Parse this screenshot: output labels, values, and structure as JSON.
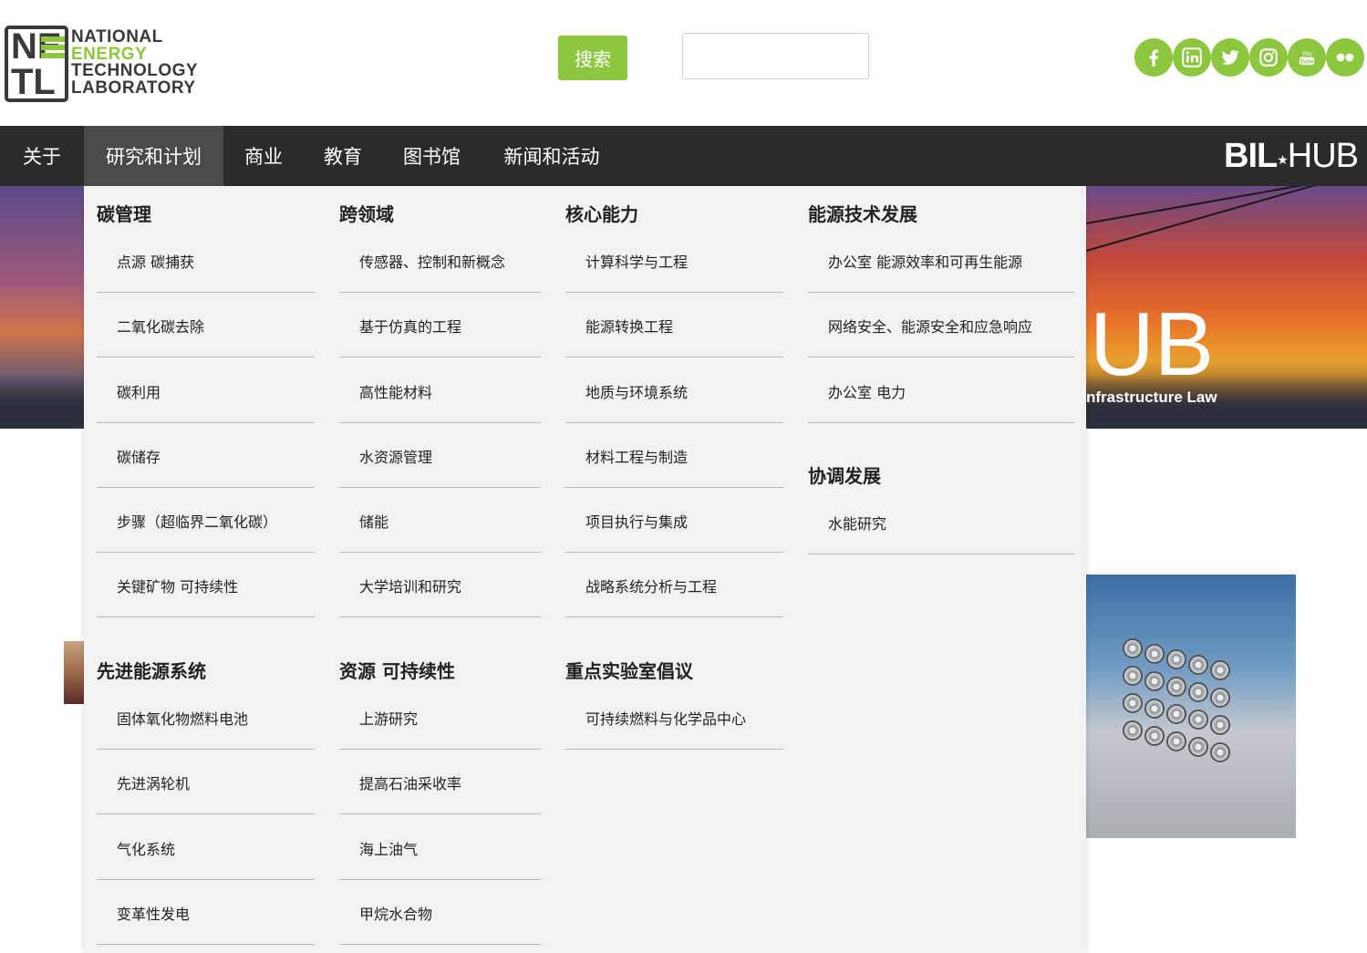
{
  "logo": {
    "mark_top": "NE",
    "mark_bottom": "TL",
    "line1": "NATIONAL",
    "line2": "ENERGY",
    "line3": "TECHNOLOGY",
    "line4": "LABORATORY"
  },
  "search": {
    "button_label": "搜索",
    "placeholder": ""
  },
  "social": [
    "facebook-icon",
    "linkedin-icon",
    "twitter-icon",
    "instagram-icon",
    "youtube-icon",
    "flickr-icon"
  ],
  "nav": {
    "items": [
      "关于",
      "研究和计划",
      "商业",
      "教育",
      "图书馆",
      "新闻和活动"
    ],
    "active": "研究和计划",
    "brand_bold": "BIL",
    "brand_thin": "HUB"
  },
  "hero": {
    "big_text": "UB",
    "subtitle": "nfrastructure Law"
  },
  "menu": {
    "col1": {
      "cat1": "碳管理",
      "items1": [
        "点源 碳捕获",
        "二氧化碳去除",
        "碳利用",
        "碳储存",
        "步骤（超临界二氧化碳）",
        "关键矿物 可持续性"
      ],
      "cat2": "先进能源系统",
      "items2": [
        "固体氧化物燃料电池",
        "先进涡轮机",
        "气化系统",
        "变革性发电"
      ]
    },
    "col2": {
      "cat1": "跨领域",
      "items1": [
        "传感器、控制和新概念",
        "基于仿真的工程",
        "高性能材料",
        "水资源管理",
        "储能",
        "大学培训和研究"
      ],
      "cat2": "资源 可持续性",
      "items2": [
        "上游研究",
        "提高石油采收率",
        "海上油气",
        "甲烷水合物"
      ]
    },
    "col3": {
      "cat1": "核心能力",
      "items1": [
        "计算科学与工程",
        "能源转换工程",
        "地质与环境系统",
        "材料工程与制造",
        "项目执行与集成",
        "战略系统分析与工程"
      ],
      "cat2": "重点实验室倡议",
      "items2": [
        "可持续燃料与化学品中心"
      ]
    },
    "col4": {
      "cat1": "能源技术发展",
      "items1": [
        "办公室 能源效率和可再生能源",
        "网络安全、能源安全和应急响应",
        "办公室 电力"
      ],
      "cat2": "协调发展",
      "items2": [
        "水能研究"
      ]
    }
  },
  "colors": {
    "accent": "#8dc63f",
    "nav_bg": "#2b2b2b",
    "nav_active": "#4a4a4a",
    "menu_bg": "#f2f2f2"
  }
}
